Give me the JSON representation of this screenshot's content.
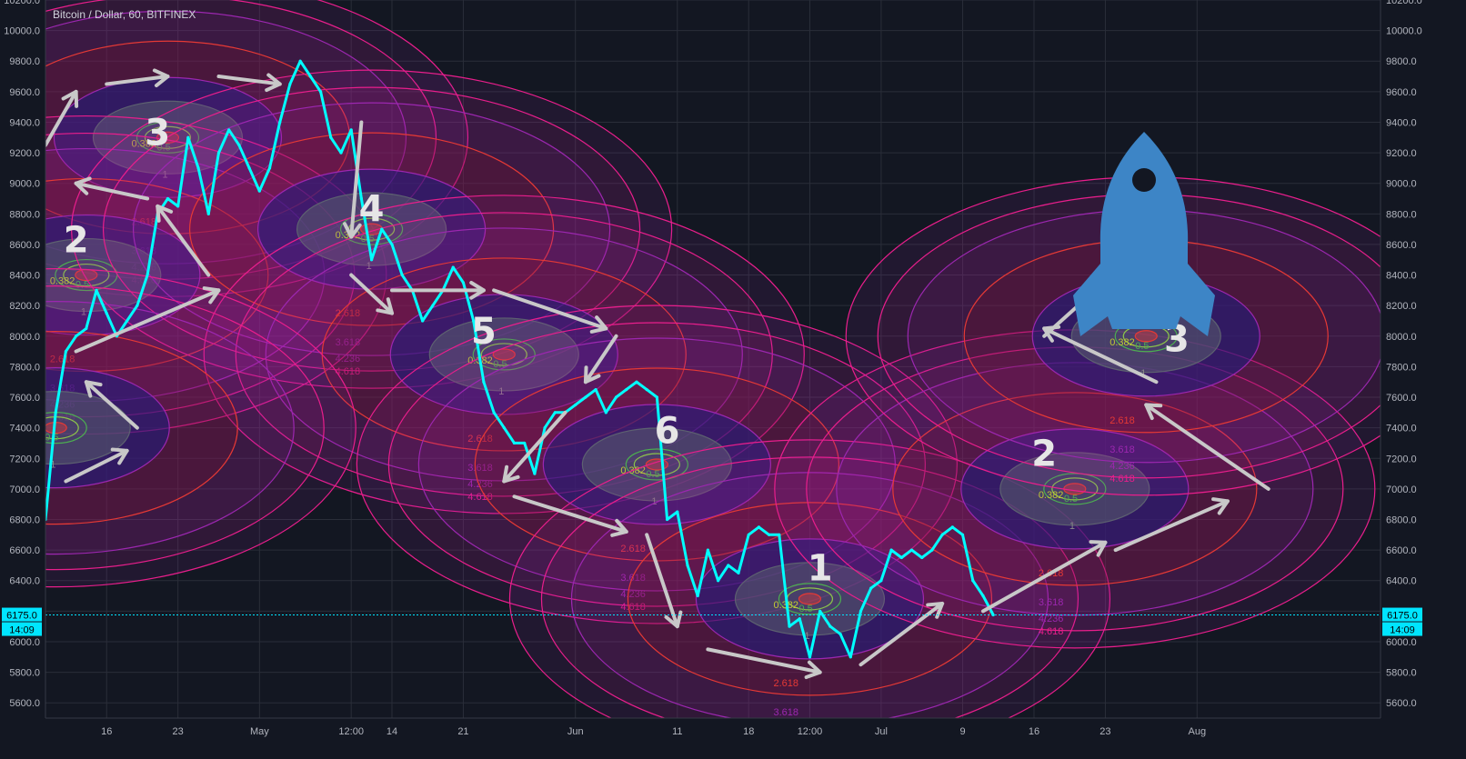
{
  "header": {
    "title": "Bitcoin / Dollar, 60, BITFINEX"
  },
  "colors": {
    "background": "#131722",
    "grid": "#2a2e39",
    "price_line": "#00ffff",
    "arrow": "#c8c8c8",
    "rocket": "#3d85c6",
    "label": "#e6e6e6",
    "fib_ring_red": "#e53935",
    "fib_ring_pink": "#e91e8c",
    "fib_ring_purple": "#9c27b0",
    "fib_ring_blue": "#2a2a8a"
  },
  "chart_data": {
    "type": "line",
    "symbol": "BTCUSD",
    "exchange": "BITFINEX",
    "interval": "60",
    "ylim": [
      5500,
      10200
    ],
    "y_ticks": [
      "10200.0",
      "10000.0",
      "9800.0",
      "9600.0",
      "9400.0",
      "9200.0",
      "9000.0",
      "8800.0",
      "8600.0",
      "8400.0",
      "8200.0",
      "8000.0",
      "7800.0",
      "7600.0",
      "7400.0",
      "7200.0",
      "7000.0",
      "6800.0",
      "6600.0",
      "6400.0",
      "6200.0",
      "6000.0",
      "5800.0",
      "5600.0"
    ],
    "x_ticks": [
      "16",
      "23",
      "May",
      "12:00",
      "14",
      "21",
      "Jun",
      "11",
      "18",
      "12:00",
      "Jul",
      "9",
      "16",
      "23",
      "Aug"
    ],
    "x_tick_dates": [
      "2018-04-16",
      "2018-04-23",
      "2018-05-01",
      "2018-05-10",
      "2018-05-14",
      "2018-05-21",
      "2018-06-01",
      "2018-06-11",
      "2018-06-18",
      "2018-06-24",
      "2018-07-01",
      "2018-07-09",
      "2018-07-16",
      "2018-07-23",
      "2018-08-01"
    ],
    "xlim": [
      "2018-04-10",
      "2018-08-19"
    ],
    "series": [
      {
        "values": [
          [
            "2018-04-10",
            6800
          ],
          [
            "2018-04-11",
            7500
          ],
          [
            "2018-04-12",
            7900
          ],
          [
            "2018-04-13",
            8000
          ],
          [
            "2018-04-14",
            8050
          ],
          [
            "2018-04-15",
            8300
          ],
          [
            "2018-04-16",
            8150
          ],
          [
            "2018-04-17",
            8000
          ],
          [
            "2018-04-18",
            8100
          ],
          [
            "2018-04-19",
            8200
          ],
          [
            "2018-04-20",
            8400
          ],
          [
            "2018-04-21",
            8800
          ],
          [
            "2018-04-22",
            8900
          ],
          [
            "2018-04-23",
            8850
          ],
          [
            "2018-04-24",
            9300
          ],
          [
            "2018-04-25",
            9100
          ],
          [
            "2018-04-26",
            8800
          ],
          [
            "2018-04-27",
            9200
          ],
          [
            "2018-04-28",
            9350
          ],
          [
            "2018-04-29",
            9250
          ],
          [
            "2018-04-30",
            9100
          ],
          [
            "2018-05-01",
            8950
          ],
          [
            "2018-05-02",
            9100
          ],
          [
            "2018-05-03",
            9400
          ],
          [
            "2018-05-04",
            9650
          ],
          [
            "2018-05-05",
            9800
          ],
          [
            "2018-05-06",
            9700
          ],
          [
            "2018-05-07",
            9600
          ],
          [
            "2018-05-08",
            9300
          ],
          [
            "2018-05-09",
            9200
          ],
          [
            "2018-05-10",
            9350
          ],
          [
            "2018-05-11",
            8900
          ],
          [
            "2018-05-12",
            8500
          ],
          [
            "2018-05-13",
            8700
          ],
          [
            "2018-05-14",
            8600
          ],
          [
            "2018-05-15",
            8400
          ],
          [
            "2018-05-16",
            8300
          ],
          [
            "2018-05-17",
            8100
          ],
          [
            "2018-05-18",
            8200
          ],
          [
            "2018-05-19",
            8300
          ],
          [
            "2018-05-20",
            8450
          ],
          [
            "2018-05-21",
            8350
          ],
          [
            "2018-05-22",
            8100
          ],
          [
            "2018-05-23",
            7700
          ],
          [
            "2018-05-24",
            7500
          ],
          [
            "2018-05-25",
            7400
          ],
          [
            "2018-05-26",
            7300
          ],
          [
            "2018-05-27",
            7300
          ],
          [
            "2018-05-28",
            7100
          ],
          [
            "2018-05-29",
            7400
          ],
          [
            "2018-05-30",
            7500
          ],
          [
            "2018-05-31",
            7500
          ],
          [
            "2018-06-01",
            7550
          ],
          [
            "2018-06-02",
            7600
          ],
          [
            "2018-06-03",
            7650
          ],
          [
            "2018-06-04",
            7500
          ],
          [
            "2018-06-05",
            7600
          ],
          [
            "2018-06-06",
            7650
          ],
          [
            "2018-06-07",
            7700
          ],
          [
            "2018-06-08",
            7650
          ],
          [
            "2018-06-09",
            7600
          ],
          [
            "2018-06-10",
            6800
          ],
          [
            "2018-06-11",
            6850
          ],
          [
            "2018-06-12",
            6500
          ],
          [
            "2018-06-13",
            6300
          ],
          [
            "2018-06-14",
            6600
          ],
          [
            "2018-06-15",
            6400
          ],
          [
            "2018-06-16",
            6500
          ],
          [
            "2018-06-17",
            6450
          ],
          [
            "2018-06-18",
            6700
          ],
          [
            "2018-06-19",
            6750
          ],
          [
            "2018-06-20",
            6700
          ],
          [
            "2018-06-21",
            6700
          ],
          [
            "2018-06-22",
            6100
          ],
          [
            "2018-06-23",
            6150
          ],
          [
            "2018-06-24",
            5900
          ],
          [
            "2018-06-25",
            6200
          ],
          [
            "2018-06-26",
            6100
          ],
          [
            "2018-06-27",
            6050
          ],
          [
            "2018-06-28",
            5900
          ],
          [
            "2018-06-29",
            6200
          ],
          [
            "2018-06-30",
            6350
          ],
          [
            "2018-07-01",
            6400
          ],
          [
            "2018-07-02",
            6600
          ],
          [
            "2018-07-03",
            6550
          ],
          [
            "2018-07-04",
            6600
          ],
          [
            "2018-07-05",
            6550
          ],
          [
            "2018-07-06",
            6600
          ],
          [
            "2018-07-07",
            6700
          ],
          [
            "2018-07-08",
            6750
          ],
          [
            "2018-07-09",
            6700
          ],
          [
            "2018-07-10",
            6400
          ],
          [
            "2018-07-11",
            6300
          ],
          [
            "2018-07-12",
            6175
          ]
        ]
      }
    ],
    "last_price": "6175.0",
    "last_time": "14:09",
    "wave_labels": [
      {
        "text": "3",
        "date": "2018-04-21",
        "price": 9250
      },
      {
        "text": "2",
        "date": "2018-04-13",
        "price": 8550
      },
      {
        "text": "4",
        "date": "2018-05-12",
        "price": 8750
      },
      {
        "text": "5",
        "date": "2018-05-23",
        "price": 7950
      },
      {
        "text": "6",
        "date": "2018-06-10",
        "price": 7300
      },
      {
        "text": "1",
        "date": "2018-06-25",
        "price": 6400
      },
      {
        "text": "2",
        "date": "2018-07-17",
        "price": 7150
      },
      {
        "text": "3",
        "date": "2018-07-30",
        "price": 7900
      }
    ],
    "fib_circles": [
      {
        "date": "2018-04-22",
        "price": 9300
      },
      {
        "date": "2018-04-14",
        "price": 8400
      },
      {
        "date": "2018-05-12",
        "price": 8700
      },
      {
        "date": "2018-05-25",
        "price": 7880
      },
      {
        "date": "2018-06-09",
        "price": 7160
      },
      {
        "date": "2018-06-24",
        "price": 6280
      },
      {
        "date": "2018-07-20",
        "price": 7000
      },
      {
        "date": "2018-07-27",
        "price": 8000
      },
      {
        "date": "2018-04-11",
        "price": 7400
      }
    ],
    "fib_levels": [
      "0.382",
      "0.5",
      "1",
      "2.618",
      "3.618",
      "4.236",
      "4.618"
    ],
    "arrows": [
      {
        "from": [
          "2018-04-10",
          9250
        ],
        "to": [
          "2018-04-13",
          9600
        ]
      },
      {
        "from": [
          "2018-04-16",
          9650
        ],
        "to": [
          "2018-04-22",
          9700
        ]
      },
      {
        "from": [
          "2018-04-27",
          9700
        ],
        "to": [
          "2018-05-03",
          9650
        ]
      },
      {
        "from": [
          "2018-04-20",
          8900
        ],
        "to": [
          "2018-04-13",
          9000
        ]
      },
      {
        "from": [
          "2018-04-26",
          8400
        ],
        "to": [
          "2018-04-21",
          8850
        ]
      },
      {
        "from": [
          "2018-04-13",
          7900
        ],
        "to": [
          "2018-04-27",
          8300
        ]
      },
      {
        "from": [
          "2018-04-19",
          7400
        ],
        "to": [
          "2018-04-14",
          7700
        ]
      },
      {
        "from": [
          "2018-04-12",
          7050
        ],
        "to": [
          "2018-04-18",
          7250
        ]
      },
      {
        "from": [
          "2018-05-11",
          9400
        ],
        "to": [
          "2018-05-10",
          8650
        ]
      },
      {
        "from": [
          "2018-05-10",
          8400
        ],
        "to": [
          "2018-05-14",
          8150
        ]
      },
      {
        "from": [
          "2018-05-14",
          8300
        ],
        "to": [
          "2018-05-23",
          8300
        ]
      },
      {
        "from": [
          "2018-05-24",
          8300
        ],
        "to": [
          "2018-06-04",
          8050
        ]
      },
      {
        "from": [
          "2018-06-05",
          8000
        ],
        "to": [
          "2018-06-02",
          7700
        ]
      },
      {
        "from": [
          "2018-05-31",
          7500
        ],
        "to": [
          "2018-05-25",
          7050
        ]
      },
      {
        "from": [
          "2018-05-26",
          6950
        ],
        "to": [
          "2018-06-06",
          6720
        ]
      },
      {
        "from": [
          "2018-06-08",
          6700
        ],
        "to": [
          "2018-06-11",
          6100
        ]
      },
      {
        "from": [
          "2018-06-14",
          5950
        ],
        "to": [
          "2018-06-25",
          5800
        ]
      },
      {
        "from": [
          "2018-06-29",
          5850
        ],
        "to": [
          "2018-07-07",
          6250
        ]
      },
      {
        "from": [
          "2018-07-11",
          6200
        ],
        "to": [
          "2018-07-23",
          6650
        ]
      },
      {
        "from": [
          "2018-07-24",
          6600
        ],
        "to": [
          "2018-08-04",
          6920
        ]
      },
      {
        "from": [
          "2018-08-08",
          7000
        ],
        "to": [
          "2018-07-27",
          7550
        ]
      },
      {
        "from": [
          "2018-07-28",
          7700
        ],
        "to": [
          "2018-07-17",
          8050
        ]
      },
      {
        "from": [
          "2018-07-17",
          8000
        ],
        "to": [
          "2018-07-22",
          8300
        ]
      }
    ]
  }
}
